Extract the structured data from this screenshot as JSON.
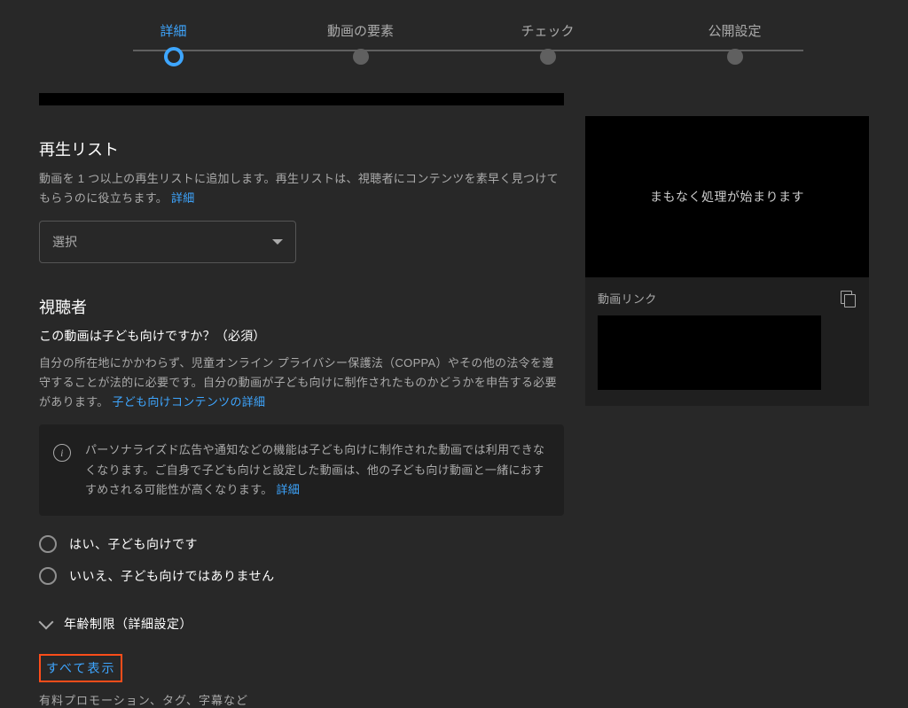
{
  "stepper": {
    "steps": [
      {
        "label": "詳細",
        "active": true
      },
      {
        "label": "動画の要素",
        "active": false
      },
      {
        "label": "チェック",
        "active": false
      },
      {
        "label": "公開設定",
        "active": false
      }
    ]
  },
  "playlists": {
    "title": "再生リスト",
    "description": "動画を 1 つ以上の再生リストに追加します。再生リストは、視聴者にコンテンツを素早く見つけてもらうのに役立ちます。",
    "detail_link": "詳細",
    "select_label": "選択"
  },
  "audience": {
    "title": "視聴者",
    "question": "この動画は子ども向けですか？（必須）",
    "explain": "自分の所在地にかかわらず、児童オンライン プライバシー保護法（COPPA）やその他の法令を遵守することが法的に必要です。自分の動画が子ども向けに制作されたものかどうかを申告する必要があります。",
    "explain_link": "子ども向けコンテンツの詳細",
    "info": "パーソナライズド広告や通知などの機能は子ども向けに制作された動画では利用できなくなります。ご自身で子ども向けと設定した動画は、他の子ども向け動画と一緒におすすめされる可能性が高くなります。",
    "info_link": "詳細",
    "radio_yes": "はい、子ども向けです",
    "radio_no": "いいえ、子ども向けではありません",
    "age_restriction": "年齢制限（詳細設定）"
  },
  "show_all": {
    "label": "すべて表示",
    "sub": "有料プロモーション、タグ、字幕など"
  },
  "preview": {
    "processing": "まもなく処理が始まります",
    "link_label": "動画リンク"
  }
}
